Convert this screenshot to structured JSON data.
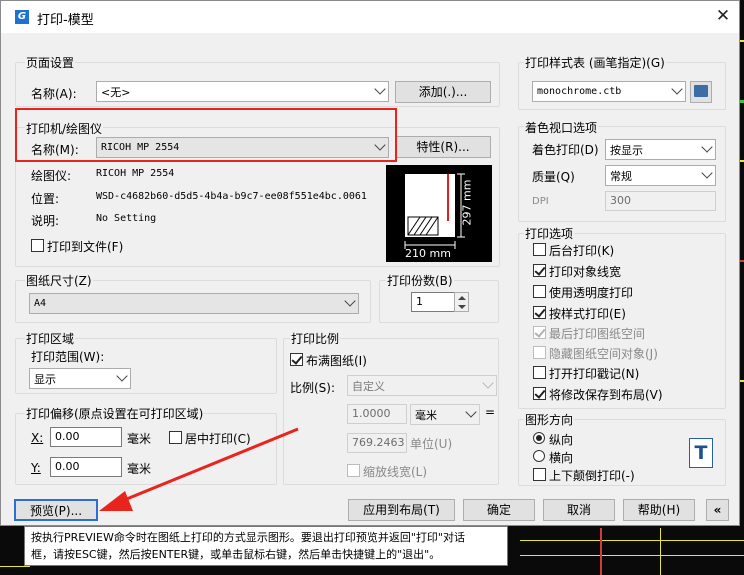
{
  "window": {
    "title": "打印-模型",
    "app_icon_letter": "G"
  },
  "page_setup": {
    "group_title": "页面设置",
    "name_label": "名称(A):",
    "name_value": "<无>",
    "add_button": "添加(.)..."
  },
  "printer": {
    "group_title": "打印机/绘图仪",
    "name_label": "名称(M):",
    "name_value": "RICOH MP 2554",
    "properties_button": "特性(R)...",
    "plotter_label": "绘图仪:",
    "plotter_value": "RICOH MP 2554",
    "location_label": "位置:",
    "location_value": "WSD-c4682b60-d5d5-4b4a-b9c7-ee08f551e4bc.0061",
    "description_label": "说明:",
    "description_value": "No Setting",
    "print_to_file": "打印到文件(F)",
    "preview_width": "210 mm",
    "preview_height": "297 mm"
  },
  "paper_size": {
    "group_title": "图纸尺寸(Z)",
    "value": "A4"
  },
  "copies": {
    "group_title": "打印份数(B)",
    "value": "1"
  },
  "print_area": {
    "group_title": "打印区域",
    "range_label": "打印范围(W):",
    "range_value": "显示"
  },
  "print_offset": {
    "group_title": "打印偏移(原点设置在可打印区域)",
    "x_label": "X:",
    "x_value": "0.00",
    "x_unit": "毫米",
    "center_label": "居中打印(C)",
    "y_label": "Y:",
    "y_value": "0.00",
    "y_unit": "毫米"
  },
  "print_scale": {
    "group_title": "打印比例",
    "fit_label": "布满图纸(I)",
    "scale_label": "比例(S):",
    "scale_value": "自定义",
    "value1": "1.0000",
    "unit_value": "毫米",
    "equals": "=",
    "value2": "769.2463",
    "unit2": "单位(U)",
    "scale_lineweights": "缩放线宽(L)"
  },
  "plot_style": {
    "group_title": "打印样式表 (画笔指定)(G)",
    "value": "monochrome.ctb"
  },
  "shaded_viewport": {
    "group_title": "着色视口选项",
    "shade_label": "着色打印(D)",
    "shade_value": "按显示",
    "quality_label": "质量(Q)",
    "quality_value": "常规",
    "dpi_label": "DPI",
    "dpi_value": "300"
  },
  "plot_options": {
    "group_title": "打印选项",
    "items": [
      {
        "label": "后台打印(K)"
      },
      {
        "label": "打印对象线宽"
      },
      {
        "label": "使用透明度打印"
      },
      {
        "label": "按样式打印(E)"
      },
      {
        "label": "最后打印图纸空间"
      },
      {
        "label": "隐藏图纸空间对象(J)"
      },
      {
        "label": "打开打印戳记(N)"
      },
      {
        "label": "将修改保存到布局(V)"
      }
    ]
  },
  "orientation": {
    "group_title": "图形方向",
    "portrait": "纵向",
    "landscape": "横向",
    "upside_down": "上下颠倒打印(-)",
    "icon_letter": "T"
  },
  "buttons": {
    "preview": "预览(P)...",
    "apply": "应用到布局(T)",
    "ok": "确定",
    "cancel": "取消",
    "help": "帮助(H)",
    "collapse": "«"
  },
  "tooltip": {
    "line1": "按执行PREVIEW命令时在图纸上打印的方式显示图形。要退出打印预览并返回\"打印\"对话",
    "line2": "框，请按ESC键，然后按ENTER键，或单击鼠标右键，然后单击快捷键上的\"退出\"。"
  },
  "colors": {
    "highlight": "#e8241c",
    "accent": "#1e73d2"
  }
}
